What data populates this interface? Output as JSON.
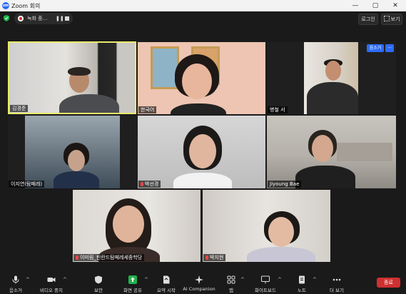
{
  "window": {
    "title": "Zoom 회의",
    "logo_text": "zm",
    "controls": [
      "—",
      "▢",
      "✕"
    ]
  },
  "topbar": {
    "recording_label": "녹화 중...",
    "pause_glyph": "❚❚",
    "login_label": "로그인",
    "view_label": "보기"
  },
  "participants": [
    {
      "name": "김경준",
      "active_speaker": true,
      "muted": false
    },
    {
      "name": "한국어",
      "active_speaker": false,
      "muted": false
    },
    {
      "name": "병철 서",
      "active_speaker": false,
      "muted": false
    },
    {
      "name": "이지연(탐페레)",
      "active_speaker": false,
      "muted": false
    },
    {
      "name": "박선경",
      "active_speaker": false,
      "muted": true
    },
    {
      "name": "Jiyoung Bae",
      "active_speaker": false,
      "muted": false
    },
    {
      "name": "이미림_핀란드탐페레세종학당",
      "active_speaker": false,
      "muted": true
    },
    {
      "name": "박지현",
      "active_speaker": false,
      "muted": true
    }
  ],
  "tile_overlay": {
    "unmute_label": "음소거",
    "more_label": "···"
  },
  "toolbar": {
    "items": [
      {
        "label": "음소거",
        "icon": "microphone-icon"
      },
      {
        "label": "비디오 중지",
        "icon": "video-camera-icon"
      },
      {
        "label": "보안",
        "icon": "shield-icon"
      },
      {
        "label": "화면 공유",
        "icon": "share-screen-icon"
      },
      {
        "label": "요약 시작",
        "icon": "summary-icon"
      },
      {
        "label": "AI Companion",
        "icon": "sparkle-icon"
      },
      {
        "label": "앱",
        "icon": "apps-icon"
      },
      {
        "label": "화이트보드",
        "icon": "whiteboard-icon"
      },
      {
        "label": "노트",
        "icon": "notes-icon"
      },
      {
        "label": "더 보기",
        "icon": "more-icon"
      }
    ],
    "end_label": "종료"
  },
  "colors": {
    "active_border": "#e9e96b",
    "accent_blue": "#2d6cf6",
    "share_green": "#22b14c",
    "end_red": "#cf3030",
    "background": "#1a1a1a"
  }
}
